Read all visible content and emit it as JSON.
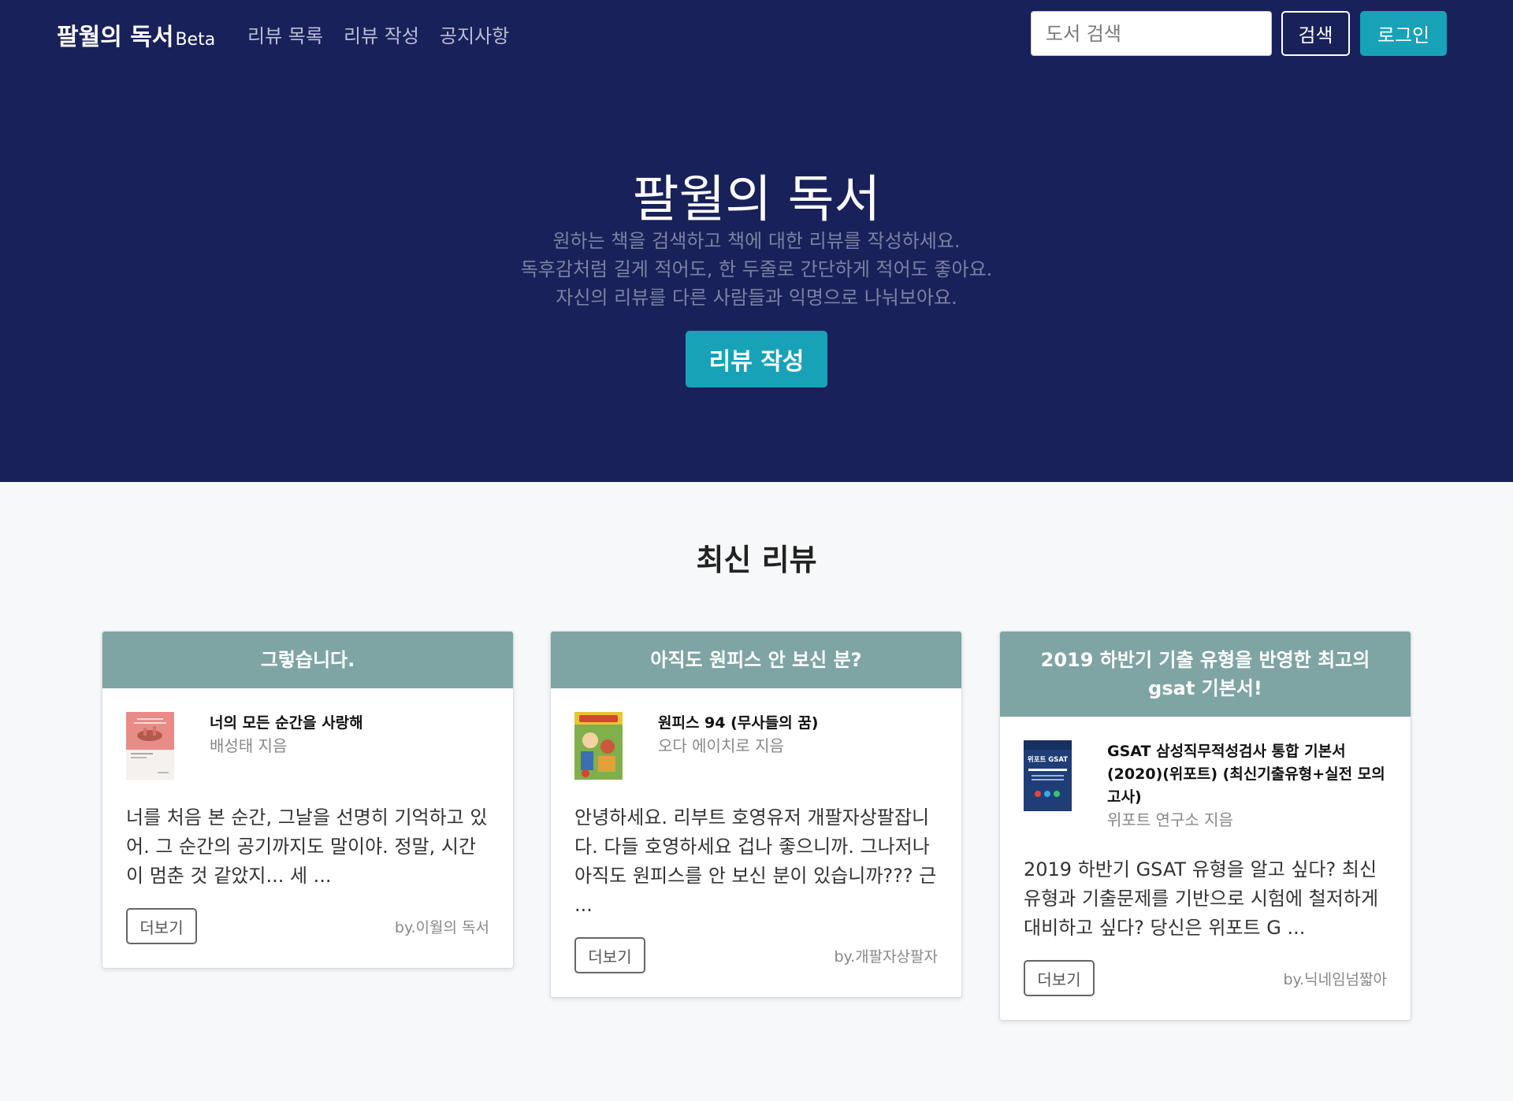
{
  "nav": {
    "brand": "팔월의 독서",
    "beta": "Beta",
    "links": [
      "리뷰 목록",
      "리뷰 작성",
      "공지사항"
    ],
    "search_placeholder": "도서 검색",
    "search_button": "검색",
    "login_button": "로그인"
  },
  "hero": {
    "title": "팔월의 독서",
    "lines": [
      "원하는 책을 검색하고 책에 대한 리뷰를 작성하세요.",
      "독후감처럼 길게 적어도, 한 두줄로 간단하게 적어도 좋아요.",
      "자신의 리뷰를 다른 사람들과 익명으로 나눠보아요."
    ],
    "button": "리뷰 작성"
  },
  "section_title": "최신 리뷰",
  "reviews": [
    {
      "title": "그렇습니다.",
      "book_title": "너의 모든 순간을 사랑해",
      "author": "배성태 지음",
      "text": "너를 처음 본 순간, 그날을 선명히 기억하고 있어. 그 순간의 공기까지도 말이야. 정말, 시간이 멈춘 것 같았지... 세 ...",
      "more": "더보기",
      "by": "by.이월의 독서"
    },
    {
      "title": "아직도 원피스 안 보신 분?",
      "book_title": "원피스 94 (무사들의 꿈)",
      "author": "오다 에이치로 지음",
      "text": "안녕하세요. 리부트 호영유저 개팔자상팔잡니다. 다들 호영하세요 겁나 좋으니까. 그나저나 아직도 원피스를 안 보신 분이 있습니까??? 근 ...",
      "more": "더보기",
      "by": "by.개팔자상팔자"
    },
    {
      "title": "2019 하반기 기출 유형을 반영한 최고의 gsat 기본서!",
      "book_title": "GSAT 삼성직무적성검사 통합 기본서 (2020)(위포트) (최신기출유형+실전 모의고사)",
      "author": "위포트 연구소 지음",
      "text": "2019 하반기 GSAT 유형을 알고 싶다? 최신 유형과 기출문제를 기반으로 시험에 철저하게 대비하고 싶다? 당신은 위포트 G ...",
      "more": "더보기",
      "by": "by.닉네임넘짧아",
      "cover_text": "위포트 GSAT"
    }
  ],
  "colors": {
    "navy": "#19215a",
    "teal": "#17a2b8",
    "card_header": "#7fa4a4"
  }
}
